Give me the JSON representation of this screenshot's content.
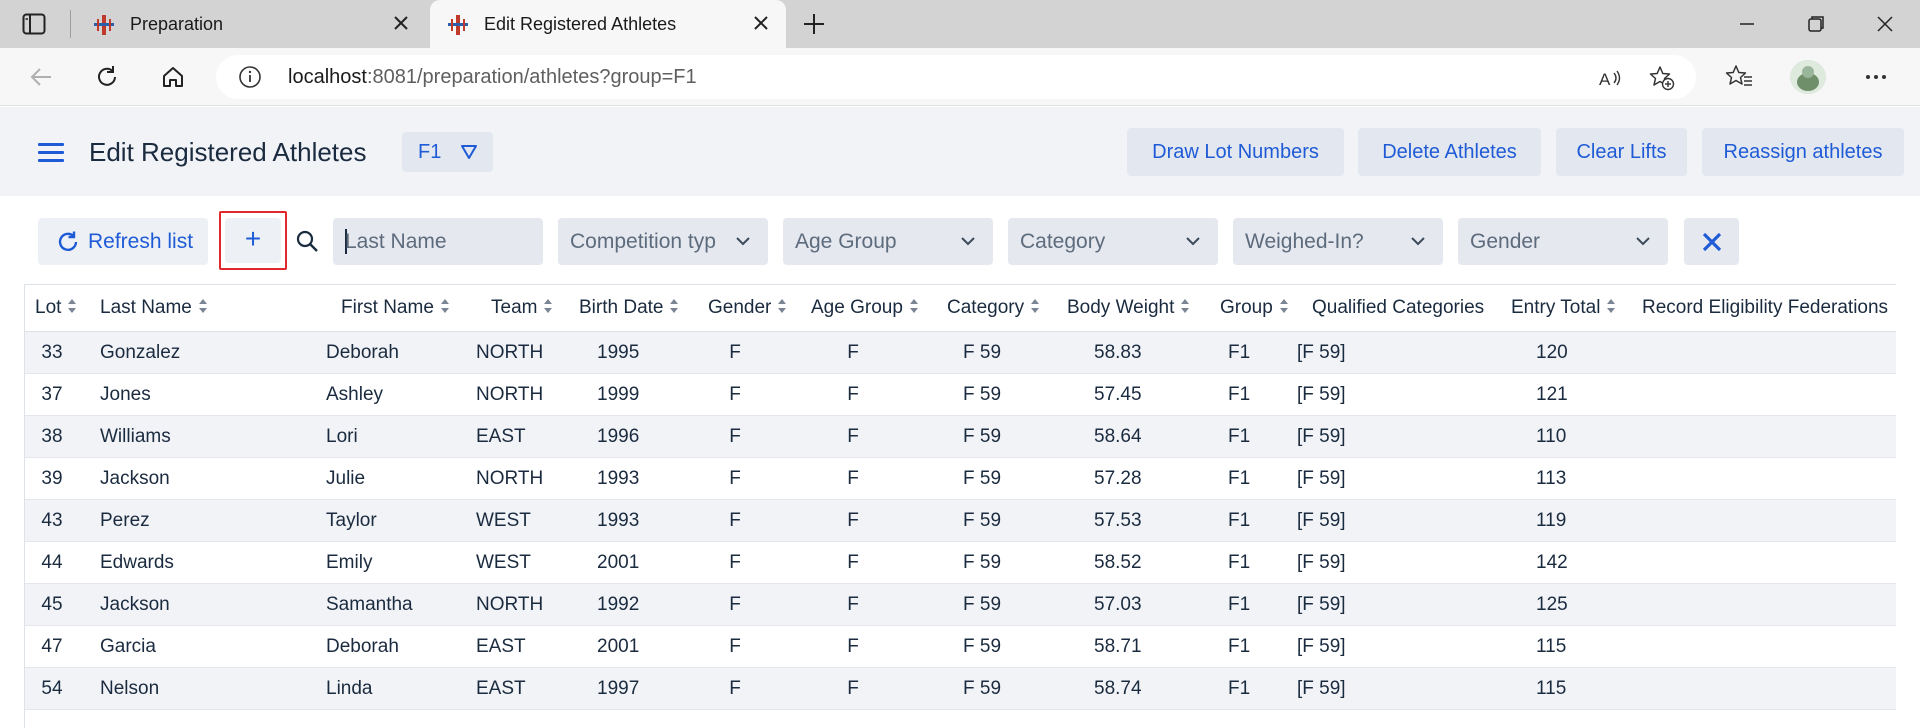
{
  "browser": {
    "tabs": [
      {
        "title": "Preparation",
        "active": false
      },
      {
        "title": "Edit Registered Athletes",
        "active": true
      }
    ],
    "url": {
      "host": "localhost",
      "rest": ":8081/preparation/athletes?group=F1"
    }
  },
  "header": {
    "title": "Edit Registered Athletes",
    "group": "F1",
    "buttons": {
      "draw_lots": "Draw Lot Numbers",
      "delete_athletes": "Delete Athletes",
      "clear_lifts": "Clear Lifts",
      "reassign": "Reassign athletes"
    }
  },
  "filters": {
    "refresh_label": "Refresh list",
    "add_label": "+",
    "last_name_placeholder": "Last Name",
    "competition_type": "Competition typ",
    "age_group": "Age Group",
    "category": "Category",
    "weighed_in": "Weighed-In?",
    "gender": "Gender"
  },
  "table": {
    "columns": {
      "lot": "Lot",
      "last_name": "Last Name",
      "first_name": "First Name",
      "team": "Team",
      "birth_date": "Birth Date",
      "gender": "Gender",
      "age_group": "Age Group",
      "category": "Category",
      "body_weight": "Body Weight",
      "group": "Group",
      "qualified_categories": "Qualified Categories",
      "entry_total": "Entry Total",
      "record_eligibility": "Record Eligibility Federations"
    },
    "rows": [
      {
        "lot": "33",
        "last_name": "Gonzalez",
        "first_name": "Deborah",
        "team": "NORTH",
        "birth": "1995",
        "gender": "F",
        "age_group": "F",
        "category": "F 59",
        "body_weight": "58.83",
        "group": "F1",
        "qualified": "[F 59]",
        "entry_total": "120"
      },
      {
        "lot": "37",
        "last_name": "Jones",
        "first_name": "Ashley",
        "team": "NORTH",
        "birth": "1999",
        "gender": "F",
        "age_group": "F",
        "category": "F 59",
        "body_weight": "57.45",
        "group": "F1",
        "qualified": "[F 59]",
        "entry_total": "121"
      },
      {
        "lot": "38",
        "last_name": "Williams",
        "first_name": "Lori",
        "team": "EAST",
        "birth": "1996",
        "gender": "F",
        "age_group": "F",
        "category": "F 59",
        "body_weight": "58.64",
        "group": "F1",
        "qualified": "[F 59]",
        "entry_total": "110"
      },
      {
        "lot": "39",
        "last_name": "Jackson",
        "first_name": "Julie",
        "team": "NORTH",
        "birth": "1993",
        "gender": "F",
        "age_group": "F",
        "category": "F 59",
        "body_weight": "57.28",
        "group": "F1",
        "qualified": "[F 59]",
        "entry_total": "113"
      },
      {
        "lot": "43",
        "last_name": "Perez",
        "first_name": "Taylor",
        "team": "WEST",
        "birth": "1993",
        "gender": "F",
        "age_group": "F",
        "category": "F 59",
        "body_weight": "57.53",
        "group": "F1",
        "qualified": "[F 59]",
        "entry_total": "119"
      },
      {
        "lot": "44",
        "last_name": "Edwards",
        "first_name": "Emily",
        "team": "WEST",
        "birth": "2001",
        "gender": "F",
        "age_group": "F",
        "category": "F 59",
        "body_weight": "58.52",
        "group": "F1",
        "qualified": "[F 59]",
        "entry_total": "142"
      },
      {
        "lot": "45",
        "last_name": "Jackson",
        "first_name": "Samantha",
        "team": "NORTH",
        "birth": "1992",
        "gender": "F",
        "age_group": "F",
        "category": "F 59",
        "body_weight": "57.03",
        "group": "F1",
        "qualified": "[F 59]",
        "entry_total": "125"
      },
      {
        "lot": "47",
        "last_name": "Garcia",
        "first_name": "Deborah",
        "team": "EAST",
        "birth": "2001",
        "gender": "F",
        "age_group": "F",
        "category": "F 59",
        "body_weight": "58.71",
        "group": "F1",
        "qualified": "[F 59]",
        "entry_total": "115"
      },
      {
        "lot": "54",
        "last_name": "Nelson",
        "first_name": "Linda",
        "team": "EAST",
        "birth": "1997",
        "gender": "F",
        "age_group": "F",
        "category": "F 59",
        "body_weight": "58.74",
        "group": "F1",
        "qualified": "[F 59]",
        "entry_total": "115"
      }
    ]
  },
  "colors": {
    "accent": "#1f5bd6",
    "highlight_border": "#e0282e",
    "header_bg": "#f1f3f7"
  },
  "icons": [
    "sidebar-toggle-icon",
    "app-favicon-icon",
    "close-icon",
    "new-tab-icon",
    "minimize-icon",
    "restore-icon",
    "back-arrow-icon",
    "reload-icon",
    "home-icon",
    "info-icon",
    "read-aloud-icon",
    "add-favorite-icon",
    "favorites-icon",
    "more-icon",
    "menu-icon",
    "filter-triangle-icon",
    "refresh-icon",
    "search-icon",
    "chevron-down-icon",
    "clear-x-icon",
    "sort-icon"
  ]
}
